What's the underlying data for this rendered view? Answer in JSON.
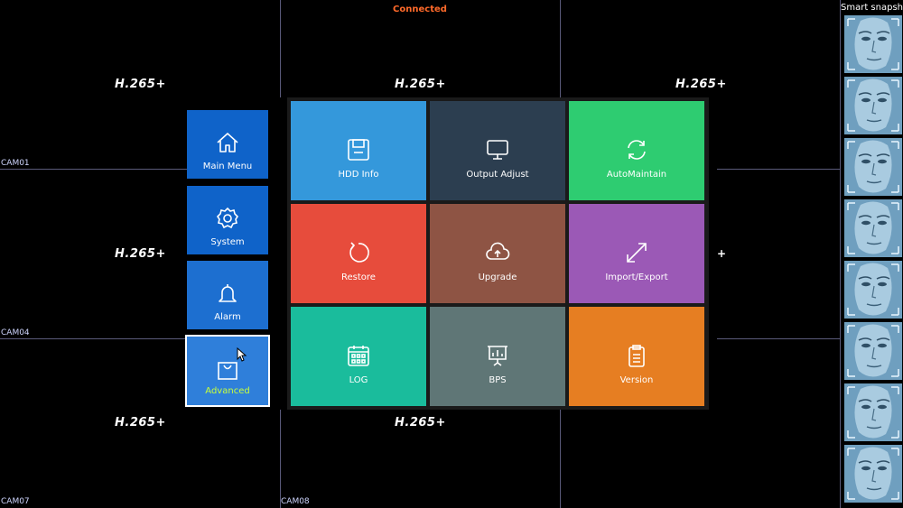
{
  "status": "Connected",
  "snapshot_title": "Smart snapshot",
  "codec_labels": [
    "H.265+",
    "H.265+",
    "H.265+",
    "H.265+",
    "H.265+",
    "H.265+"
  ],
  "plus_mark": "+",
  "cameras": [
    "CAM01",
    "CAM04",
    "CAM07",
    "CAM08"
  ],
  "sidebar": {
    "items": [
      {
        "label": "Main Menu",
        "icon": "home-icon"
      },
      {
        "label": "System",
        "icon": "gear-icon"
      },
      {
        "label": "Alarm",
        "icon": "bell-icon"
      },
      {
        "label": "Advanced",
        "icon": "bag-icon",
        "active": true
      }
    ]
  },
  "tiles": [
    {
      "label": "HDD Info",
      "icon": "floppy-disk-icon",
      "color": "#3498db"
    },
    {
      "label": "Output Adjust",
      "icon": "monitor-icon",
      "color": "#2c3e50"
    },
    {
      "label": "AutoMaintain",
      "icon": "refresh-icon",
      "color": "#2ecc71"
    },
    {
      "label": "Restore",
      "icon": "restore-icon",
      "color": "#e74c3c"
    },
    {
      "label": "Upgrade",
      "icon": "cloud-upload-icon",
      "color": "#8e5444"
    },
    {
      "label": "Import/Export",
      "icon": "expand-arrows-icon",
      "color": "#9b59b6"
    },
    {
      "label": "LOG",
      "icon": "calendar-icon",
      "color": "#1abc9c"
    },
    {
      "label": "BPS",
      "icon": "presentation-chart-icon",
      "color": "#5f7676"
    },
    {
      "label": "Version",
      "icon": "clipboard-icon",
      "color": "#e67e22"
    }
  ]
}
